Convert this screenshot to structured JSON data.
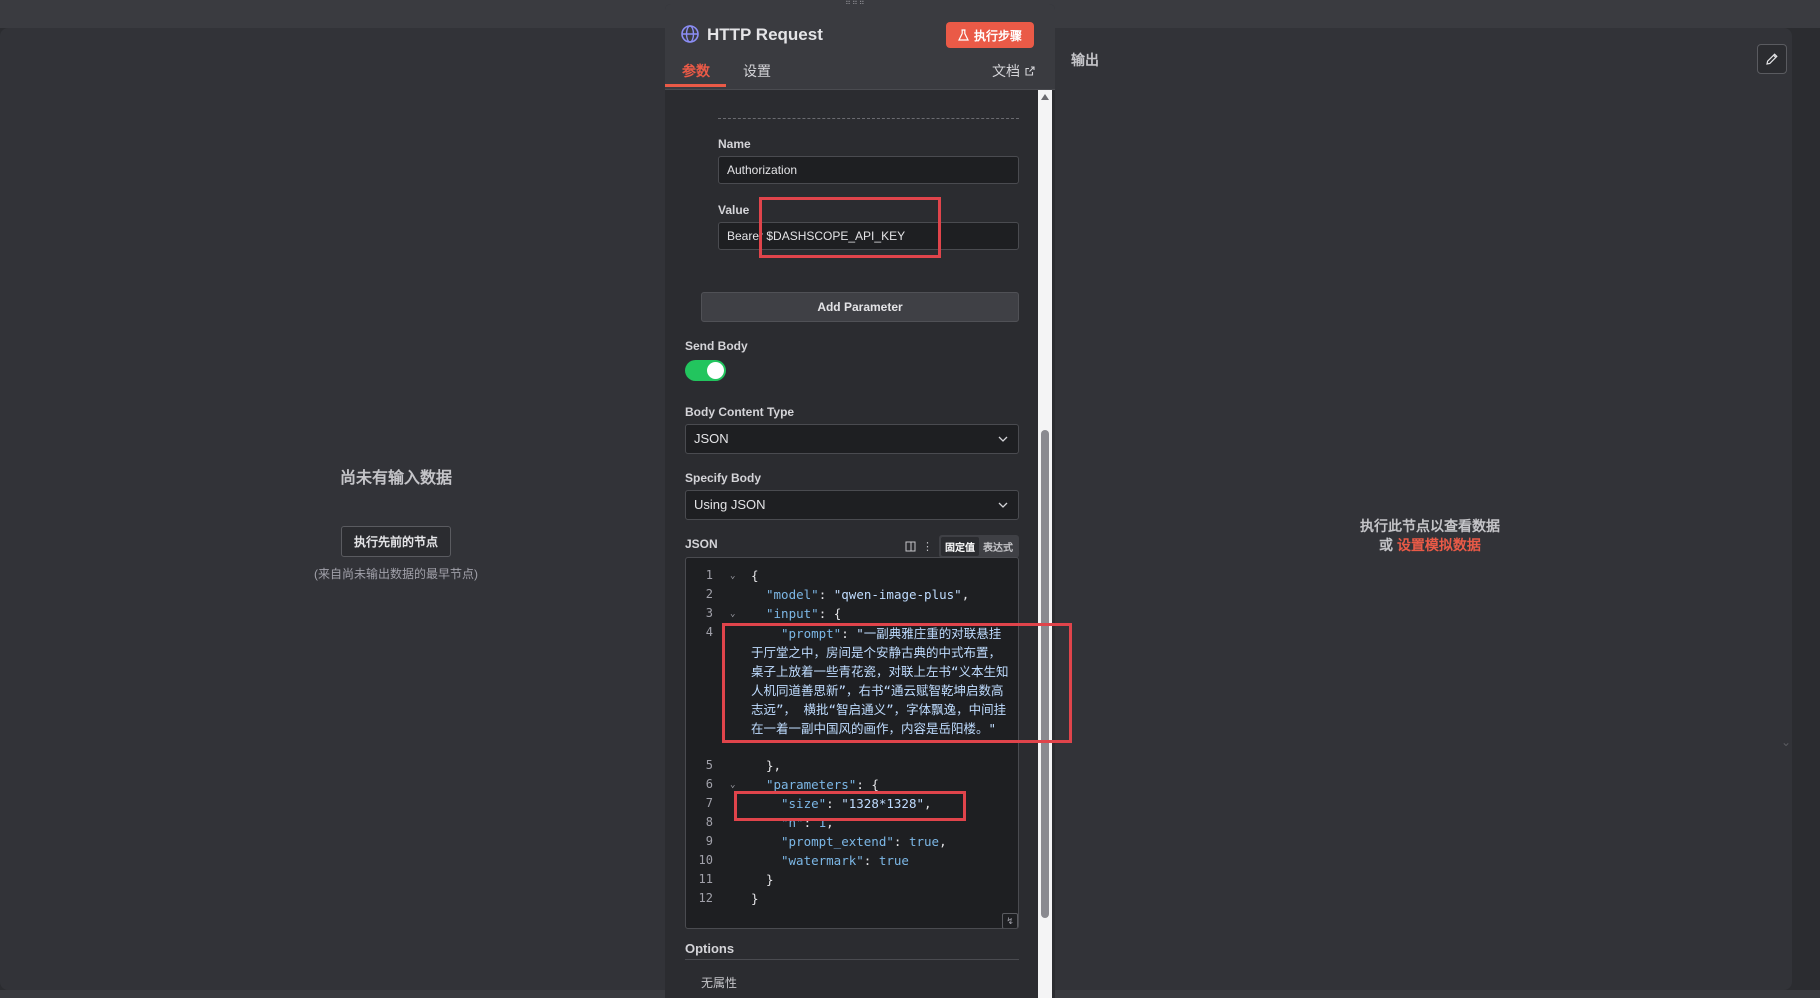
{
  "input_panel": {
    "empty_title": "尚未有输入数据",
    "exec_prev_button": "执行先前的节点",
    "hint": "(来自尚未输出数据的最早节点)"
  },
  "output_panel": {
    "title": "输出",
    "empty_line1": "执行此节点以查看数据",
    "empty_or": "或",
    "mock_link": "设置模拟数据"
  },
  "node": {
    "title": "HTTP Request",
    "exec_step_button": "执行步骤",
    "tabs": [
      {
        "label": "参数",
        "active": true
      },
      {
        "label": "设置",
        "active": false
      }
    ],
    "docs_label": "文档"
  },
  "header_param": {
    "name_label": "Name",
    "name_value": "Authorization",
    "value_label": "Value",
    "value_value": "Bearer $DASHSCOPE_API_KEY"
  },
  "add_parameter_label": "Add Parameter",
  "send_body": {
    "label": "Send Body",
    "enabled": true
  },
  "body_content_type": {
    "label": "Body Content Type",
    "selected": "JSON"
  },
  "specify_body": {
    "label": "Specify Body",
    "selected": "Using JSON"
  },
  "json_editor": {
    "label": "JSON",
    "mode_fixed": "固定值",
    "mode_expression": "表达式",
    "line_numbers": [
      "1",
      "2",
      "3",
      "4",
      "5",
      "6",
      "7",
      "8",
      "9",
      "10",
      "11",
      "12"
    ],
    "lines": {
      "l1": "{",
      "l2_key": "\"model\"",
      "l2_val": "\"qwen-image-plus\"",
      "l3_key": "\"input\"",
      "l3_rest": "{",
      "l4_key": "\"prompt\"",
      "l4_text": "\"一副典雅庄重的对联悬挂于厅堂之中，房间是个安静古典的中式布置，桌子上放着一些青花瓷，对联上左书“义本生知人机同道善思新”，右书“通云赋智乾坤启数高志远”， 横批“智启通义”，字体飘逸，中间挂在一着一副中国风的画作，内容是岳阳楼。\"",
      "l5": "},",
      "l6_key": "\"parameters\"",
      "l6_rest": "{",
      "l7_key": "\"size\"",
      "l7_val": "\"1328*1328\"",
      "l8_key": "\"n\"",
      "l8_val": "1",
      "l9_key": "\"prompt_extend\"",
      "l9_val": "true",
      "l10_key": "\"watermark\"",
      "l10_val": "true",
      "l11": "}",
      "l12": "}"
    }
  },
  "options": {
    "label": "Options",
    "empty": "无属性"
  },
  "colors": {
    "accent": "#ea5a47",
    "toggle_on": "#22c55e",
    "annotation": "#e0444b",
    "json_key": "#7cb7e6"
  },
  "icons": {
    "node": "globe-icon",
    "exec": "flask-icon",
    "docs": "external-link-icon",
    "edit": "pencil-icon",
    "select": "chevron-down-icon"
  }
}
